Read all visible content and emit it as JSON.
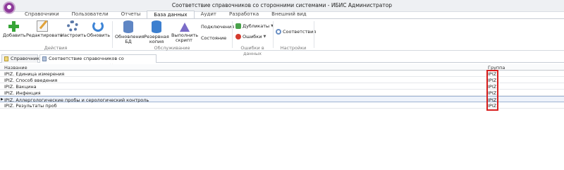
{
  "window": {
    "title": "Соответствие справочников со сторонними системами - ИБИС Администратор"
  },
  "ribbon_tabs": [
    "Справочники",
    "Пользователи",
    "Отчеты",
    "База данных",
    "Аудит",
    "Разработка",
    "Внешний вид"
  ],
  "ribbon": {
    "add": "Добавить",
    "edit": "Редактировать",
    "configure": "Настроить",
    "refresh": "Обновить",
    "group_actions": "Действия",
    "update_db_line1": "Обновления",
    "update_db_line2": "БД",
    "backup_line1": "Резервная",
    "backup_line2": "копия",
    "run_script_line1": "Выполнить",
    "run_script_line2": "скрипт",
    "connections": "Подключения",
    "status": "Состояние",
    "group_maintenance": "Обслуживание",
    "duplicates": "Дубликаты",
    "errors": "Ошибки",
    "group_data_errors": "Ошибки в данных",
    "mappings": "Соответствия",
    "group_settings": "Настройки"
  },
  "doc_tabs": {
    "tab1": "Справочники",
    "tab2": "Соответствие справочников со сторонними системами"
  },
  "grid": {
    "headers": {
      "name": "Название",
      "group": "Группа"
    },
    "rows": [
      {
        "name": "IPIZ. Единица измерения",
        "group": "IPIZ"
      },
      {
        "name": "IPIZ. Способ введения",
        "group": "IPIZ"
      },
      {
        "name": "IPIZ. Вакцина",
        "group": "IPIZ"
      },
      {
        "name": "IPIZ. Инфекция",
        "group": "IPIZ"
      },
      {
        "name": "IPIZ. Аллергологические пробы и серологический контроль",
        "group": "IPIZ"
      },
      {
        "name": "IPIZ. Результаты проб",
        "group": "IPIZ"
      }
    ]
  },
  "colors": {
    "highlight": "#d81e1e",
    "accent": "#3c7fcf"
  }
}
